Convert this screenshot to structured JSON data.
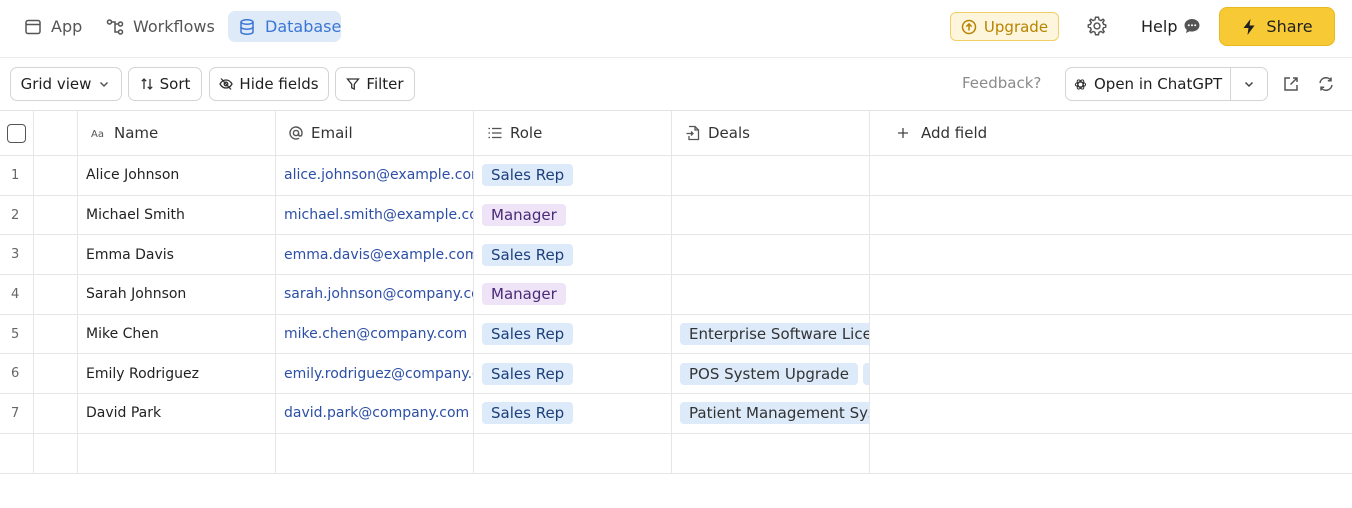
{
  "nav": {
    "tabs": [
      {
        "label": "App",
        "icon": "app-window-icon"
      },
      {
        "label": "Workflows",
        "icon": "workflow-icon"
      },
      {
        "label": "Database",
        "icon": "database-icon",
        "active": true
      }
    ],
    "upgrade_label": "Upgrade",
    "help_label": "Help",
    "share_label": "Share"
  },
  "toolbar": {
    "grid_view_label": "Grid view",
    "sort_label": "Sort",
    "hide_fields_label": "Hide fields",
    "filter_label": "Filter",
    "feedback_label": "Feedback?",
    "open_chatgpt_label": "Open in ChatGPT"
  },
  "table": {
    "columns": [
      {
        "label": "Name",
        "icon": "text-type-icon"
      },
      {
        "label": "Email",
        "icon": "at-sign-icon"
      },
      {
        "label": "Role",
        "icon": "list-icon"
      },
      {
        "label": "Deals",
        "icon": "linked-record-icon"
      }
    ],
    "add_field_label": "Add field",
    "rows": [
      {
        "num": "1",
        "name": "Alice Johnson",
        "email": "alice.johnson@example.com",
        "role": "Sales Rep",
        "deals": []
      },
      {
        "num": "2",
        "name": "Michael Smith",
        "email": "michael.smith@example.com",
        "role": "Manager",
        "deals": []
      },
      {
        "num": "3",
        "name": "Emma Davis",
        "email": "emma.davis@example.com",
        "role": "Sales Rep",
        "deals": []
      },
      {
        "num": "4",
        "name": "Sarah Johnson",
        "email": "sarah.johnson@company.com",
        "role": "Manager",
        "deals": []
      },
      {
        "num": "5",
        "name": "Mike Chen",
        "email": "mike.chen@company.com",
        "role": "Sales Rep",
        "deals": [
          "Enterprise Software License"
        ]
      },
      {
        "num": "6",
        "name": "Emily Rodriguez",
        "email": "emily.rodriguez@company.com",
        "role": "Sales Rep",
        "deals": [
          "POS System Upgrade",
          ""
        ]
      },
      {
        "num": "7",
        "name": "David Park",
        "email": "david.park@company.com",
        "role": "Sales Rep",
        "deals": [
          "Patient Management System"
        ]
      }
    ]
  },
  "colors": {
    "accent": "#3a76d4",
    "share": "#f6c935",
    "upgrade": "#b88300",
    "chip_sales": "#dceafa",
    "chip_manager": "#eee3f7"
  }
}
